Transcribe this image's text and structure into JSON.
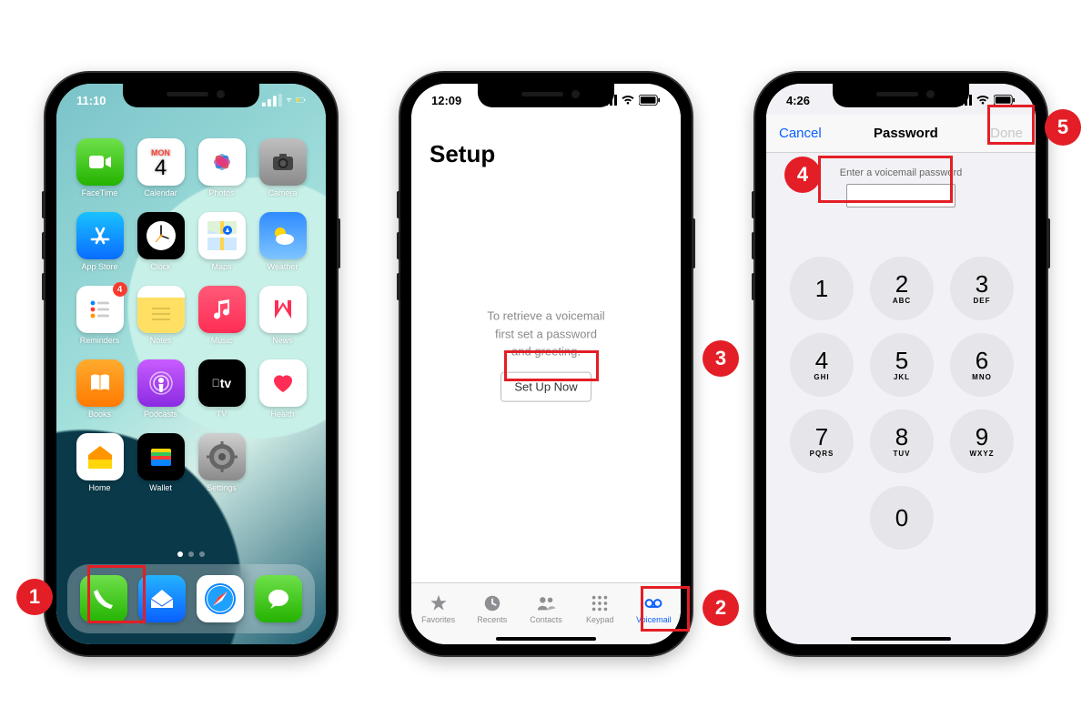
{
  "callouts": [
    "1",
    "2",
    "3",
    "4",
    "5"
  ],
  "phone1": {
    "time": "11:10",
    "calendar": {
      "dow": "MON",
      "day": "4"
    },
    "apps_row1": [
      "FaceTime",
      "Calendar",
      "Photos",
      "Camera"
    ],
    "apps_row2": [
      "App Store",
      "Clock",
      "Maps",
      "Weather"
    ],
    "apps_row3": [
      "Reminders",
      "Notes",
      "Music",
      "News"
    ],
    "apps_row4": [
      "Books",
      "Podcasts",
      "TV",
      "Health"
    ],
    "apps_row5": [
      "Home",
      "Wallet",
      "Settings"
    ],
    "reminders_badge": "4",
    "tv_label": "tv"
  },
  "phone2": {
    "time": "12:09",
    "title": "Setup",
    "message_l1": "To retrieve a voicemail",
    "message_l2": "first set a password",
    "message_l3": "and greeting.",
    "button": "Set Up Now",
    "tabs": [
      "Favorites",
      "Recents",
      "Contacts",
      "Keypad",
      "Voicemail"
    ]
  },
  "phone3": {
    "time": "4:26",
    "nav_cancel": "Cancel",
    "nav_title": "Password",
    "nav_done": "Done",
    "prompt": "Enter a voicemail password",
    "keys": [
      {
        "n": "1",
        "l": ""
      },
      {
        "n": "2",
        "l": "ABC"
      },
      {
        "n": "3",
        "l": "DEF"
      },
      {
        "n": "4",
        "l": "GHI"
      },
      {
        "n": "5",
        "l": "JKL"
      },
      {
        "n": "6",
        "l": "MNO"
      },
      {
        "n": "7",
        "l": "PQRS"
      },
      {
        "n": "8",
        "l": "TUV"
      },
      {
        "n": "9",
        "l": "WXYZ"
      },
      {
        "n": "",
        "l": ""
      },
      {
        "n": "0",
        "l": ""
      },
      {
        "n": "",
        "l": ""
      }
    ]
  }
}
